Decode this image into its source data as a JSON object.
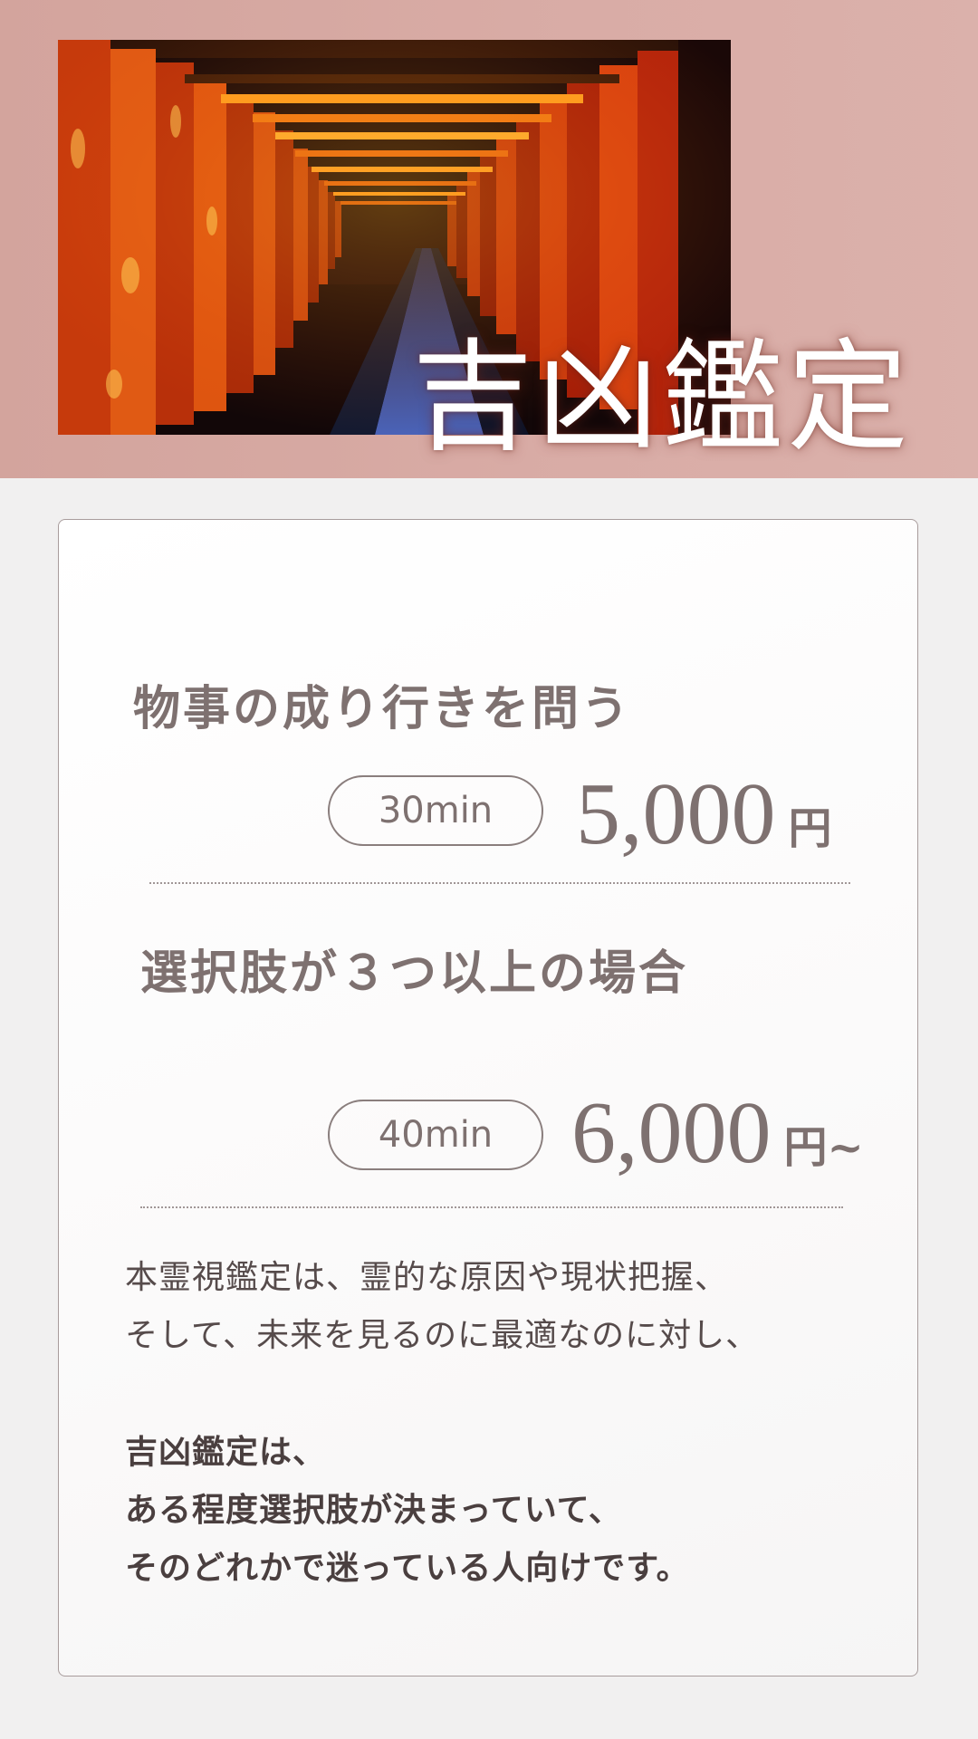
{
  "hero": {
    "title": "吉凶鑑定"
  },
  "plans": [
    {
      "title": "物事の成り行きを問う",
      "duration": "30min",
      "price": "5,000",
      "unit": "円"
    },
    {
      "title": "選択肢が３つ以上の場合",
      "duration": "40min",
      "price": "6,000",
      "unit": "円~"
    }
  ],
  "description": {
    "lines": [
      "本霊視鑑定は、霊的な原因や現状把握、",
      "そして、未来を見るのに最適なのに対し、"
    ],
    "bold_lines": [
      "吉凶鑑定は、",
      "ある程度選択肢が決まっていて、",
      "そのどれかで迷っている人向けです。"
    ]
  },
  "colors": {
    "band": "#d7aaa4",
    "text_muted": "#7e7170",
    "text_dark": "#4a3f3f",
    "torii_red": "#d8420f",
    "path_blue": "#2e4a9c"
  },
  "image": {
    "subject": "torii-gate-tunnel-photo"
  }
}
